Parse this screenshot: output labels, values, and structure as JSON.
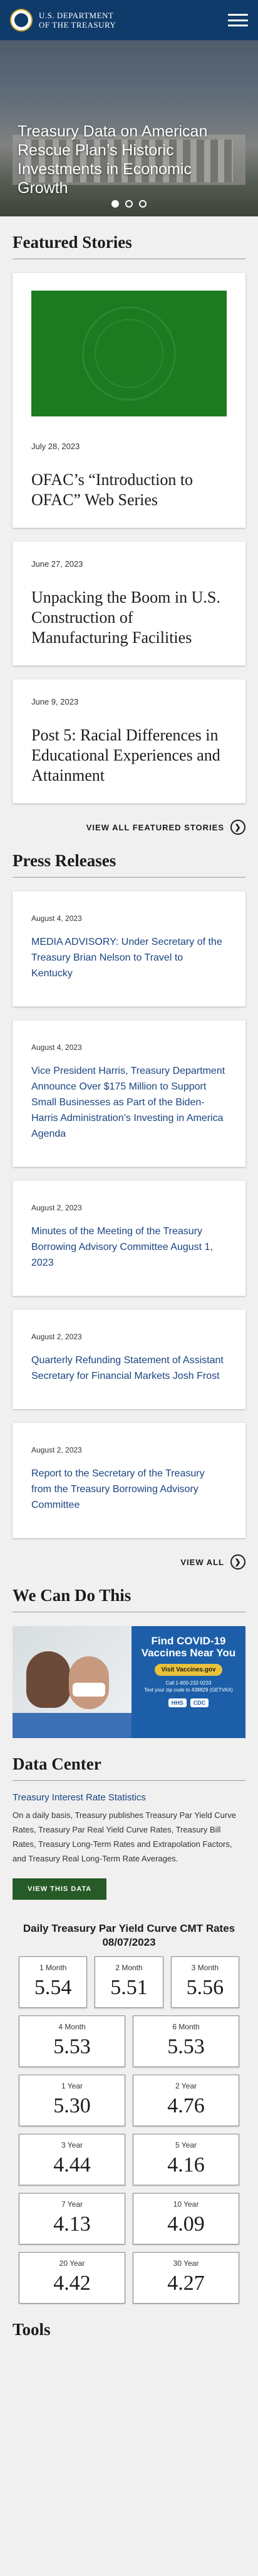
{
  "header": {
    "line1": "U.S. DEPARTMENT",
    "line2": "OF THE TREASURY"
  },
  "hero": {
    "title": "Treasury Data on American Rescue Plan’s Historic Investments in Economic Growth"
  },
  "featured": {
    "heading": "Featured Stories",
    "cards": [
      {
        "date": "July 28, 2023",
        "title": "OFAC’s “Introduction to OFAC” Web Series"
      },
      {
        "date": "June 27, 2023",
        "title": "Unpacking the Boom in U.S. Construction of Manufacturing Facilities"
      },
      {
        "date": "June 9, 2023",
        "title": "Post 5: Racial Differences in Educational Experiences and Attainment"
      }
    ],
    "view_all": "VIEW ALL FEATURED STORIES"
  },
  "press": {
    "heading": "Press Releases",
    "items": [
      {
        "date": "August 4, 2023",
        "title": "MEDIA ADVISORY: Under Secretary of the Treasury Brian Nelson to Travel to Kentucky"
      },
      {
        "date": "August 4, 2023",
        "title": "Vice President Harris, Treasury Department Announce Over $175 Million to Support Small Businesses as Part of the Biden-Harris Administration’s Investing in America Agenda"
      },
      {
        "date": "August 2, 2023",
        "title": "Minutes of the Meeting of the Treasury Borrowing Advisory Committee August 1, 2023"
      },
      {
        "date": "August 2, 2023",
        "title": "Quarterly Refunding Statement of Assistant Secretary for Financial Markets Josh Frost"
      },
      {
        "date": "August 2, 2023",
        "title": "Report to the Secretary of the Treasury from the Treasury Borrowing Advisory Committee"
      }
    ],
    "view_all": "VIEW ALL"
  },
  "wecando": {
    "heading": "We Can Do This",
    "ad_title": "Find COVID-19 Vaccines Near You",
    "ad_button": "Visit Vaccines.gov",
    "ad_call": "Call 1-800-232-0233",
    "ad_text": "Text your zip code to 438829 (GETVAX)",
    "logo1": "HHS",
    "logo2": "CDC"
  },
  "datacenter": {
    "heading": "Data Center",
    "link": "Treasury Interest Rate Statistics",
    "text": "On a daily basis, Treasury publishes Treasury Par Yield Curve Rates, Treasury Par Real Yield Curve Rates, Treasury Bill Rates, Treasury Long-Term Rates and Extrapolation Factors, and Treasury Real Long-Term Rate Averages.",
    "button": "VIEW THIS DATA",
    "yield_title": "Daily Treasury Par Yield Curve CMT Rates",
    "yield_date": "08/07/2023",
    "rates_top": [
      {
        "label": "1 Month",
        "value": "5.54"
      },
      {
        "label": "2 Month",
        "value": "5.51"
      },
      {
        "label": "3 Month",
        "value": "5.56"
      }
    ],
    "rates": [
      {
        "label": "4 Month",
        "value": "5.53"
      },
      {
        "label": "6 Month",
        "value": "5.53"
      },
      {
        "label": "1 Year",
        "value": "5.30"
      },
      {
        "label": "2 Year",
        "value": "4.76"
      },
      {
        "label": "3 Year",
        "value": "4.44"
      },
      {
        "label": "5 Year",
        "value": "4.16"
      },
      {
        "label": "7 Year",
        "value": "4.13"
      },
      {
        "label": "10 Year",
        "value": "4.09"
      },
      {
        "label": "20 Year",
        "value": "4.42"
      },
      {
        "label": "30 Year",
        "value": "4.27"
      }
    ]
  },
  "tools": {
    "heading": "Tools"
  }
}
